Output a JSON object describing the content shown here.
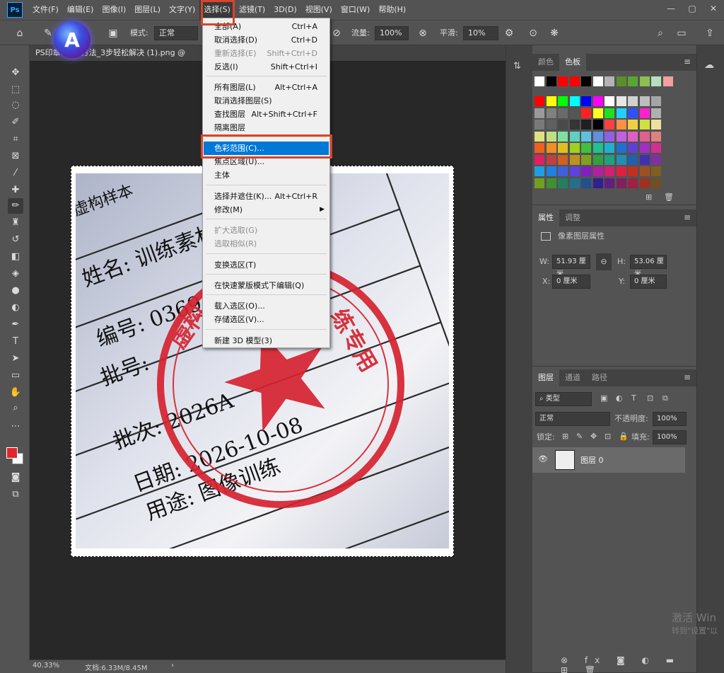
{
  "menubar": {
    "logo": "Ps",
    "items": [
      "文件(F)",
      "编辑(E)",
      "图像(I)",
      "图层(L)",
      "文字(Y)",
      "选择(S)",
      "滤镜(T)",
      "3D(D)",
      "视图(V)",
      "窗口(W)",
      "帮助(H)"
    ],
    "active_index": 5
  },
  "window_controls": {
    "minimize": "—",
    "restore": "▢",
    "close": "✕"
  },
  "options": {
    "mode_label": "模式:",
    "mode_value": "正常",
    "flow_label": "流量:",
    "flow_value": "100%",
    "smooth_label": "平滑:",
    "smooth_value": "10%"
  },
  "ai_badge": "A",
  "document": {
    "tab_title": "PS印章…3种方法_3步轻松解决 (1).png @",
    "zoom": "40.33%",
    "doc_info": "文档:6.33M/8.45M"
  },
  "photo_text": {
    "row1": "虚构样本",
    "name": "姓名: 训练素材",
    "number": "编号: 0369",
    "batch_no": "批号:",
    "batch": "批次: 2026A",
    "date": "日期: 2026-10-08",
    "purpose": "用途: 图像训练",
    "stamp_left": "虚构",
    "stamp_right": "练专用"
  },
  "select_menu": {
    "items": [
      {
        "label": "全部(A)",
        "shortcut": "Ctrl+A",
        "disabled": false
      },
      {
        "label": "取消选择(D)",
        "shortcut": "Ctrl+D",
        "disabled": false
      },
      {
        "label": "重新选择(E)",
        "shortcut": "Shift+Ctrl+D",
        "disabled": true
      },
      {
        "label": "反选(I)",
        "shortcut": "Shift+Ctrl+I",
        "disabled": false
      },
      {
        "label": "所有图层(L)",
        "shortcut": "Alt+Ctrl+A",
        "disabled": false
      },
      {
        "label": "取消选择图层(S)",
        "shortcut": "",
        "disabled": false
      },
      {
        "label": "查找图层",
        "shortcut": "Alt+Shift+Ctrl+F",
        "disabled": false
      },
      {
        "label": "隔离图层",
        "shortcut": "",
        "disabled": false
      },
      {
        "label": "色彩范围(C)...",
        "shortcut": "",
        "disabled": false
      },
      {
        "label": "焦点区域(U)...",
        "shortcut": "",
        "disabled": false
      },
      {
        "label": "主体",
        "shortcut": "",
        "disabled": false
      },
      {
        "label": "选择并遮住(K)...",
        "shortcut": "Alt+Ctrl+R",
        "disabled": false
      },
      {
        "label": "修改(M)",
        "shortcut": "",
        "disabled": false
      },
      {
        "label": "扩大选取(G)",
        "shortcut": "",
        "disabled": true
      },
      {
        "label": "选取相似(R)",
        "shortcut": "",
        "disabled": true
      },
      {
        "label": "变换选区(T)",
        "shortcut": "",
        "disabled": false
      },
      {
        "label": "在快速蒙版模式下编辑(Q)",
        "shortcut": "",
        "disabled": false
      },
      {
        "label": "载入选区(O)...",
        "shortcut": "",
        "disabled": false
      },
      {
        "label": "存储选区(V)...",
        "shortcut": "",
        "disabled": false
      },
      {
        "label": "新建 3D 模型(3)",
        "shortcut": "",
        "disabled": false
      }
    ],
    "highlighted_index": 8
  },
  "color_panel": {
    "tabs": [
      "颜色",
      "色板"
    ],
    "active_index": 1
  },
  "properties_panel": {
    "tabs": [
      "属性",
      "调整"
    ],
    "subtitle": "像素图层属性",
    "w_label": "W:",
    "w_value": "51.93 厘米",
    "h_label": "H:",
    "h_value": "53.06 厘米",
    "x_label": "X:",
    "x_value": "0 厘米",
    "y_label": "Y:",
    "y_value": "0 厘米"
  },
  "layers_panel": {
    "tabs": [
      "图层",
      "通道",
      "路径"
    ],
    "filter_kind": "类型",
    "blend_mode": "正常",
    "opacity_label": "不透明度:",
    "opacity_value": "100%",
    "lock_label": "锁定:",
    "fill_label": "填充:",
    "fill_value": "100%",
    "layer_name": "图层 0"
  },
  "watermark": {
    "line1": "激活 Win",
    "line2": "转到\"设置\"以"
  },
  "colors": {
    "accent_blue": "#0078d7",
    "annotation_red": "#d9442a",
    "foreground": "#e0262b",
    "background": "#ffffff"
  }
}
